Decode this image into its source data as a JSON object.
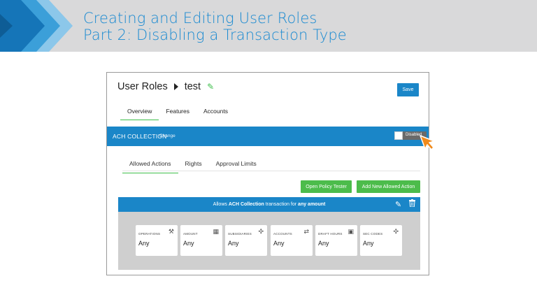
{
  "header": {
    "title_line1": "Creating and Editing User Roles",
    "title_line2": "Part 2: Disabling a Transaction Type"
  },
  "page": {
    "breadcrumb_root": "User Roles",
    "breadcrumb_current": "test",
    "save_label": "Save",
    "tabs": [
      "Overview",
      "Features",
      "Accounts"
    ],
    "active_tab": "Overview"
  },
  "ach_bar": {
    "name": "ACH COLLECTION",
    "change_label": "Change",
    "toggle_label": "Disabled"
  },
  "subtabs": {
    "items": [
      "Allowed Actions",
      "Rights",
      "Approval Limits"
    ],
    "active": "Allowed Actions"
  },
  "buttons": {
    "open_policy_tester": "Open Policy Tester",
    "add_allowed_action": "Add New Allowed Action"
  },
  "action_panel": {
    "prefix": "Allows ",
    "transaction": "ACH Collection",
    "middle": " transaction for ",
    "amount": "any amount",
    "cards": [
      {
        "label": "OPERATIONS",
        "value": "Any",
        "icon": "wrench-icon"
      },
      {
        "label": "AMOUNT",
        "value": "Any",
        "icon": "building-icon"
      },
      {
        "label": "SUBSIDIARIES",
        "value": "Any",
        "icon": "puzzle-icon"
      },
      {
        "label": "ACCOUNTS",
        "value": "Any",
        "icon": "transfer-icon"
      },
      {
        "label": "DRAFT HOURS",
        "value": "Any",
        "icon": "calendar-icon"
      },
      {
        "label": "SEC CODES",
        "value": "Any",
        "icon": "puzzle-icon"
      }
    ]
  },
  "colors": {
    "brand_blue": "#1a86c8",
    "accent_green": "#4cbc4b",
    "cursor_orange": "#f08a1c"
  }
}
